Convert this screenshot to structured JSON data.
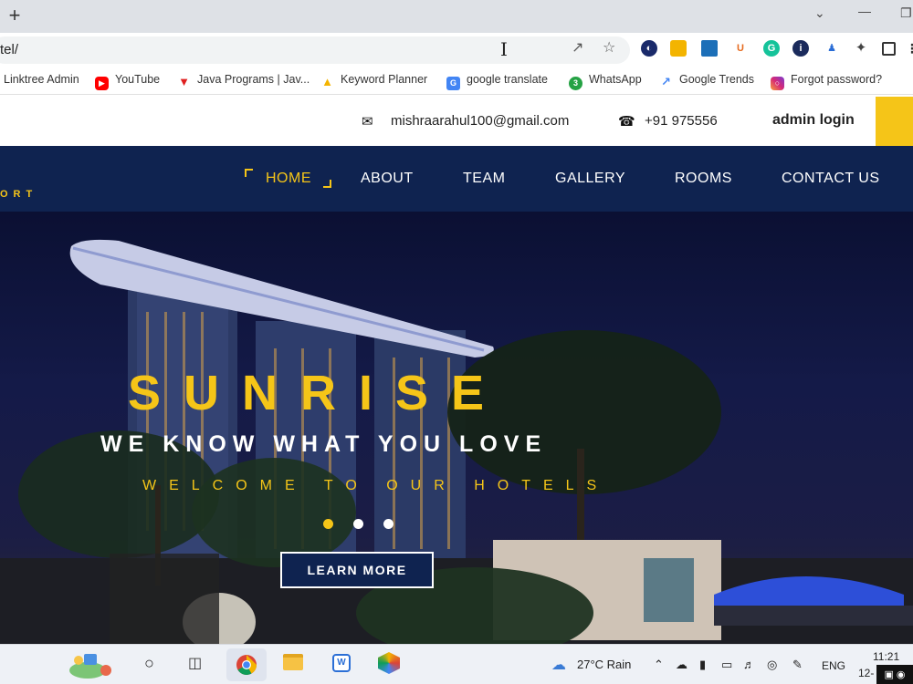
{
  "browser": {
    "url": "tel/",
    "bookmarks": [
      {
        "label": "Linktree Admin",
        "icon": "linktree-icon"
      },
      {
        "label": "YouTube",
        "icon": "youtube-icon"
      },
      {
        "label": "Java Programs | Jav...",
        "icon": "java-programs-icon"
      },
      {
        "label": "Keyword Planner",
        "icon": "google-ads-icon"
      },
      {
        "label": "google translate",
        "icon": "google-translate-icon"
      },
      {
        "label": "WhatsApp",
        "icon": "whatsapp-icon"
      },
      {
        "label": "Google Trends",
        "icon": "google-trends-icon"
      },
      {
        "label": "Forgot password?",
        "icon": "instagram-icon"
      }
    ]
  },
  "site": {
    "contact": {
      "email": "mishraarahul100@gmail.com",
      "phone": "+91 975556",
      "admin_login": "admin login"
    },
    "logo_fragment": "ORT",
    "nav": [
      "HOME",
      "ABOUT",
      "TEAM",
      "GALLERY",
      "ROOMS",
      "CONTACT US"
    ],
    "active_nav": "HOME",
    "hero": {
      "title": "SUNRISE",
      "subtitle": "WE KNOW WHAT YOU LOVE",
      "tagline": "WELCOME TO OUR HOTELS",
      "slide_count": 3,
      "active_slide": 1,
      "button": "LEARN MORE"
    }
  },
  "taskbar": {
    "weather": "27°C  Rain",
    "language": "ENG",
    "time": "11:21",
    "date": "12-"
  },
  "colors": {
    "accent": "#f5c518",
    "navy": "#0f2350"
  }
}
